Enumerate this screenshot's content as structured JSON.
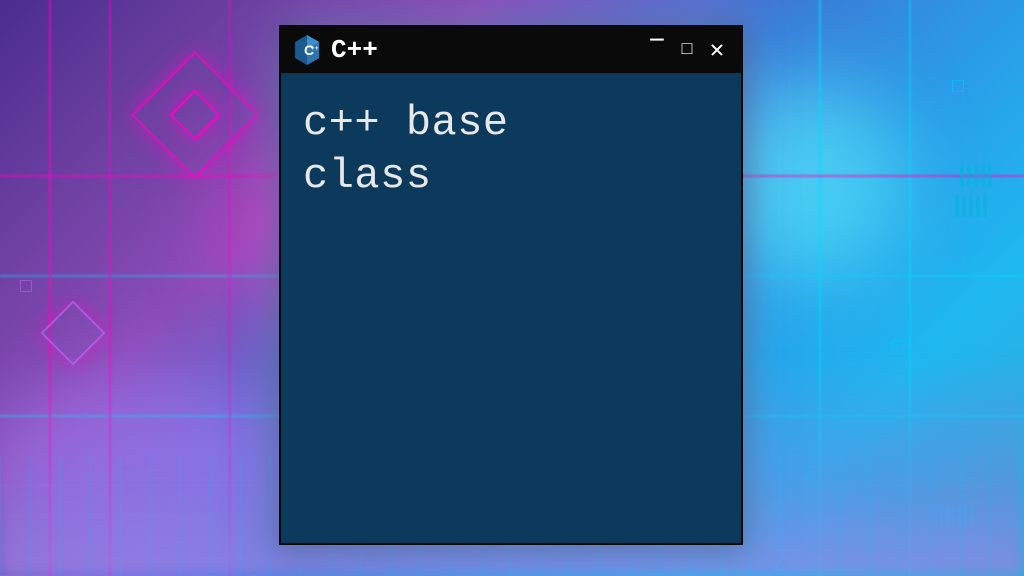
{
  "window": {
    "title": "C++",
    "content_line1": "c++ base",
    "content_line2": "class"
  },
  "icons": {
    "logo": "cpp-logo",
    "minimize": "−",
    "maximize": "□",
    "close": "✕"
  },
  "colors": {
    "content_bg": "#0b3a5c",
    "titlebar_bg": "#0a0a0a",
    "text": "#e8e8e8"
  }
}
